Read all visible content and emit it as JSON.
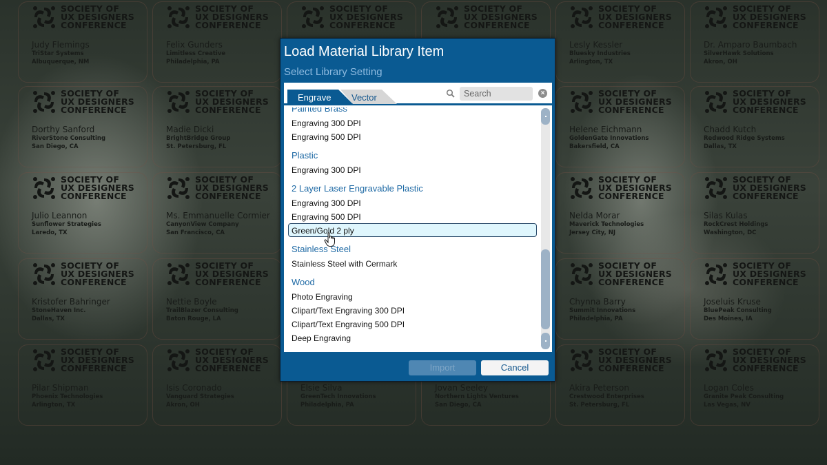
{
  "background": {
    "logo_text": [
      "SOCIETY OF",
      "UX DESIGNERS",
      "CONFERENCE"
    ],
    "badges": [
      {
        "name": "Judy Flemings",
        "company": "TriStar Systems",
        "city": "Albuquerque, NM"
      },
      {
        "name": "Felix Gunders",
        "company": "Limitless Creative",
        "city": "Philadelphia, PA"
      },
      {
        "name": "",
        "company": "",
        "city": ""
      },
      {
        "name": "",
        "company": "",
        "city": ""
      },
      {
        "name": "Lesly Kessler",
        "company": "Bluesky Industries",
        "city": "Arlington, TX"
      },
      {
        "name": "Dr. Amparo Baumbach",
        "company": "SilverHawk Solutions",
        "city": "Akron, OH"
      },
      {
        "name": "Dorthy Sanford",
        "company": "RiverStone Consulting",
        "city": "San Diego, CA"
      },
      {
        "name": "Madie Dicki",
        "company": "BrightBridge Group",
        "city": "St. Petersburg, FL"
      },
      {
        "name": "",
        "company": "",
        "city": ""
      },
      {
        "name": "",
        "company": "",
        "city": ""
      },
      {
        "name": "Helene Eichmann",
        "company": "GoldenGate Innovations",
        "city": "Bakersfield, CA"
      },
      {
        "name": "Chadd Kutch",
        "company": "Redwood Ridge Systems",
        "city": "Dallas, TX"
      },
      {
        "name": "Julio Leannon",
        "company": "Sunflower Strategies",
        "city": "Laredo, TX"
      },
      {
        "name": "Ms. Emmanuelle Cormier",
        "company": "CanyonView Company",
        "city": "San Francisco, CA"
      },
      {
        "name": "",
        "company": "",
        "city": ""
      },
      {
        "name": "",
        "company": "",
        "city": ""
      },
      {
        "name": "Nelda Morar",
        "company": "Maverick Technologies",
        "city": "Jersey City, NJ"
      },
      {
        "name": "Silas Kulas",
        "company": "RockCrest Holdings",
        "city": "Washington, DC"
      },
      {
        "name": "Kristofer Bahringer",
        "company": "StoneHaven Inc.",
        "city": "Dallas, TX"
      },
      {
        "name": "Nettie Boyle",
        "company": "TrailBlazer Consulting",
        "city": "Baton Rouge, LA"
      },
      {
        "name": "",
        "company": "",
        "city": ""
      },
      {
        "name": "",
        "company": "",
        "city": ""
      },
      {
        "name": "Chynna Barry",
        "company": "Summit Innovations",
        "city": "Philadelphia, PA"
      },
      {
        "name": "Joseluis Kruse",
        "company": "BluePeak Consulting",
        "city": "Des Moines, IA"
      },
      {
        "name": "Pilar Shipman",
        "company": "Phoenix Technologies",
        "city": "Arlington, TX"
      },
      {
        "name": "Isis Coronado",
        "company": "Vanguard Strategies",
        "city": "Akron, OH"
      },
      {
        "name": "Elsie Silva",
        "company": "GreenTech Innovations",
        "city": "Philadelphia, PA"
      },
      {
        "name": "Jovan Seeley",
        "company": "Northern Lights Ventures",
        "city": "San Diego, CA"
      },
      {
        "name": "Akira Peterson",
        "company": "Crestwood Enterprises",
        "city": "St. Petersburg, FL"
      },
      {
        "name": "Logan Coles",
        "company": "Granite Peak Consulting",
        "city": "Las Vegas, NV"
      }
    ]
  },
  "dialog": {
    "title": "Load Material Library Item",
    "subtitle": "Select Library Setting",
    "tabs": [
      {
        "label": "Engrave",
        "active": true
      },
      {
        "label": "Vector",
        "active": false
      }
    ],
    "search": {
      "placeholder": "Search",
      "value": ""
    },
    "icons": {
      "search": "search-icon",
      "clear": "clear-search-icon",
      "cursor": "hand-pointer-cursor"
    },
    "groups": [
      {
        "title": "Painted Brass",
        "items": [
          "Engraving 300 DPI",
          "Engraving 500 DPI"
        ]
      },
      {
        "title": "Plastic",
        "items": [
          "Engraving 300 DPI"
        ]
      },
      {
        "title": "2 Layer Laser Engravable Plastic",
        "items": [
          "Engraving 300 DPI",
          "Engraving 500 DPI",
          "Green/Gold 2 ply"
        ]
      },
      {
        "title": "Stainless Steel",
        "items": [
          "Stainless Steel with Cermark"
        ]
      },
      {
        "title": "Wood",
        "items": [
          "Photo Engraving",
          "Clipart/Text Engraving 300 DPI",
          "Clipart/Text Engraving 500 DPI",
          "Deep Engraving"
        ]
      }
    ],
    "selected_item": "Green/Gold 2 ply",
    "buttons": {
      "import": "Import",
      "cancel": "Cancel"
    },
    "import_enabled": false,
    "colors": {
      "dialog_bg": "#0a5a92",
      "group_title": "#1f6aa5",
      "selected_bg": "#dff6fd"
    }
  }
}
